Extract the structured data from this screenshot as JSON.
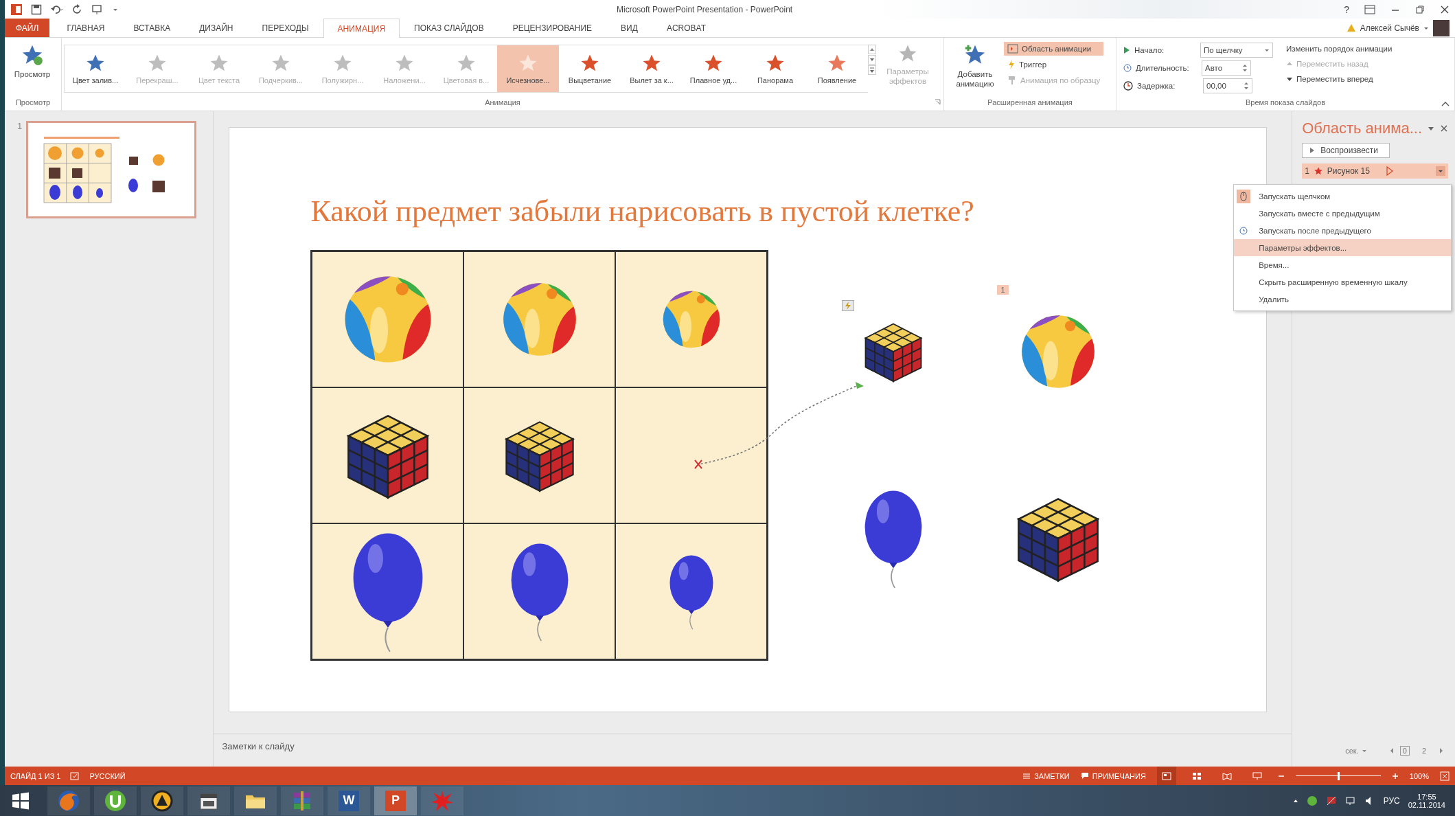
{
  "window": {
    "title": "Microsoft PowerPoint Presentation - PowerPoint",
    "help": "?",
    "user": "Алексей Сычёв"
  },
  "tabs": [
    {
      "label": "ФАЙЛ",
      "kind": "file",
      "selected": false
    },
    {
      "label": "ГЛАВНАЯ",
      "kind": "tab",
      "selected": false
    },
    {
      "label": "ВСТАВКА",
      "kind": "tab",
      "selected": false
    },
    {
      "label": "ДИЗАЙН",
      "kind": "tab",
      "selected": false
    },
    {
      "label": "ПЕРЕХОДЫ",
      "kind": "tab",
      "selected": false
    },
    {
      "label": "АНИМАЦИЯ",
      "kind": "tab",
      "selected": true
    },
    {
      "label": "ПОКАЗ СЛАЙДОВ",
      "kind": "tab",
      "selected": false
    },
    {
      "label": "РЕЦЕНЗИРОВАНИЕ",
      "kind": "tab",
      "selected": false
    },
    {
      "label": "ВИД",
      "kind": "tab",
      "selected": false
    },
    {
      "label": "ACROBAT",
      "kind": "tab",
      "selected": false
    }
  ],
  "ribbon": {
    "preview": {
      "label": "Просмотр",
      "group": "Просмотр"
    },
    "animations": {
      "group": "Анимация",
      "items": [
        {
          "label": "Цвет залив...",
          "disabled": false,
          "selected": false,
          "color": "#3f6fb5"
        },
        {
          "label": "Перекраш...",
          "disabled": true,
          "selected": false
        },
        {
          "label": "Цвет текста",
          "disabled": true,
          "selected": false
        },
        {
          "label": "Подчеркив...",
          "disabled": true,
          "selected": false
        },
        {
          "label": "Полужирн...",
          "disabled": true,
          "selected": false
        },
        {
          "label": "Наложени...",
          "disabled": true,
          "selected": false
        },
        {
          "label": "Цветовая в...",
          "disabled": true,
          "selected": false
        },
        {
          "label": "Исчезнове...",
          "disabled": false,
          "selected": true,
          "color": "#fbe6dc"
        },
        {
          "label": "Выцветание",
          "disabled": false,
          "selected": false,
          "color": "#d9502a"
        },
        {
          "label": "Вылет за к...",
          "disabled": false,
          "selected": false,
          "color": "#d9502a"
        },
        {
          "label": "Плавное уд...",
          "disabled": false,
          "selected": false,
          "color": "#d9502a"
        },
        {
          "label": "Панорама",
          "disabled": false,
          "selected": false,
          "color": "#d9502a"
        },
        {
          "label": "Появление",
          "disabled": false,
          "selected": false,
          "color": "#e8795a"
        }
      ]
    },
    "effect_options": {
      "label": "Параметры эффектов",
      "disabled": true
    },
    "advanced": {
      "group": "Расширенная анимация",
      "add": "Добавить анимацию",
      "pane": {
        "label": "Область анимации",
        "selected": true
      },
      "trigger": "Триггер",
      "painter": {
        "label": "Анимация по образцу",
        "disabled": true
      }
    },
    "timing": {
      "group": "Время показа слайдов",
      "start": {
        "label": "Начало:",
        "value": "По щелчку"
      },
      "duration": {
        "label": "Длительность:",
        "value": "Авто"
      },
      "delay": {
        "label": "Задержка:",
        "value": "00,00"
      },
      "reorder": "Изменить порядок анимации",
      "move_back": {
        "label": "Переместить назад",
        "disabled": true
      },
      "move_forward": {
        "label": "Переместить вперед",
        "disabled": false
      }
    }
  },
  "thumbnails": [
    {
      "number": "1",
      "selected": true
    }
  ],
  "slide": {
    "title": "Какой предмет забыли нарисовать в пустой клетке?",
    "grid": [
      [
        {
          "kind": "ball"
        },
        {
          "kind": "ball"
        },
        {
          "kind": "ball"
        }
      ],
      [
        {
          "kind": "cube"
        },
        {
          "kind": "cube"
        },
        {
          "kind": "empty"
        }
      ],
      [
        {
          "kind": "balloon"
        },
        {
          "kind": "balloon"
        },
        {
          "kind": "balloon"
        }
      ]
    ],
    "objects": [
      {
        "kind": "cube",
        "badge": {
          "kind": "icon"
        }
      },
      {
        "kind": "ball",
        "badge": {
          "kind": "number",
          "text": "1"
        }
      },
      {
        "kind": "balloon"
      },
      {
        "kind": "cube"
      }
    ]
  },
  "notes": {
    "placeholder": "Заметки к слайду"
  },
  "animation_pane": {
    "title": "Область анима...",
    "play": "Воспроизвести",
    "items": [
      {
        "number": "1",
        "name": "Рисунок 15",
        "selected": true
      }
    ],
    "timeline": {
      "unit": "сек.",
      "ticks": [
        "0",
        "2"
      ]
    }
  },
  "context_menu": {
    "items": [
      {
        "label": "Запускать щелчком",
        "kind": "on_click",
        "checked": true,
        "selected": false
      },
      {
        "label": "Запускать вместе с предыдущим",
        "kind": "with_previous",
        "checked": false,
        "selected": false
      },
      {
        "label": "Запускать после предыдущего",
        "kind": "after_previous",
        "checked": false,
        "selected": false
      },
      {
        "label": "Параметры эффектов...",
        "kind": "command",
        "checked": false,
        "selected": true
      },
      {
        "label": "Время...",
        "kind": "command",
        "checked": false,
        "selected": false
      },
      {
        "label": "Скрыть расширенную временную шкалу",
        "kind": "command",
        "checked": false,
        "selected": false
      },
      {
        "label": "Удалить",
        "kind": "command",
        "checked": false,
        "selected": false
      }
    ]
  },
  "status_bar": {
    "slide": "СЛАЙД 1 ИЗ 1",
    "language": "РУССКИЙ",
    "notes": "ЗАМЕТКИ",
    "comments": "ПРИМЕЧАНИЯ",
    "views": [
      {
        "kind": "normal",
        "selected": true
      },
      {
        "kind": "sorter",
        "selected": false
      },
      {
        "kind": "reading",
        "selected": false
      },
      {
        "kind": "show",
        "selected": false
      }
    ],
    "zoom": {
      "level": 0.5,
      "label": "100%"
    }
  },
  "taskbar": {
    "apps": [
      {
        "kind": "browser",
        "selected": false
      },
      {
        "kind": "torrent",
        "selected": false
      },
      {
        "kind": "player",
        "selected": false
      },
      {
        "kind": "calendar",
        "selected": false
      },
      {
        "kind": "folder",
        "selected": false
      },
      {
        "kind": "archive",
        "selected": false
      },
      {
        "kind": "word",
        "letter": "W",
        "selected": false
      },
      {
        "kind": "powerpoint",
        "letter": "P",
        "selected": true
      },
      {
        "kind": "splat",
        "selected": false
      }
    ],
    "tray": {
      "language": "РУС",
      "time": "17:55",
      "date": "02.11.2014"
    }
  }
}
